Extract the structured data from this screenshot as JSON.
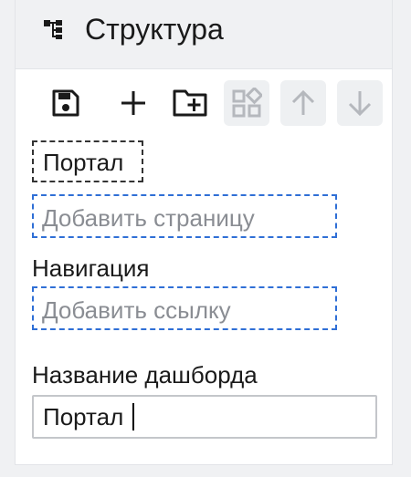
{
  "panel": {
    "title": "Структура",
    "title_icon": "tree-structure-icon"
  },
  "toolbar": {
    "buttons": [
      {
        "name": "save-icon",
        "enabled": true
      },
      {
        "name": "plus-icon",
        "enabled": true
      },
      {
        "name": "folder-plus-icon",
        "enabled": true
      },
      {
        "name": "grid-widget-icon",
        "enabled": false
      },
      {
        "name": "arrow-up-icon",
        "enabled": false
      },
      {
        "name": "arrow-down-icon",
        "enabled": false
      }
    ]
  },
  "structure": {
    "root_node_label": "Портал",
    "add_page_placeholder": "Добавить страницу",
    "navigation_label": "Навигация",
    "add_link_placeholder": "Добавить ссылку"
  },
  "dashboard": {
    "name_label": "Название дашборда",
    "name_value": "Портал"
  },
  "colors": {
    "accent_dashed": "#2f6fd6",
    "icon_active": "#1a1a1a",
    "icon_disabled": "#b5b8bd",
    "panel_header_bg": "#f0f1f3"
  }
}
